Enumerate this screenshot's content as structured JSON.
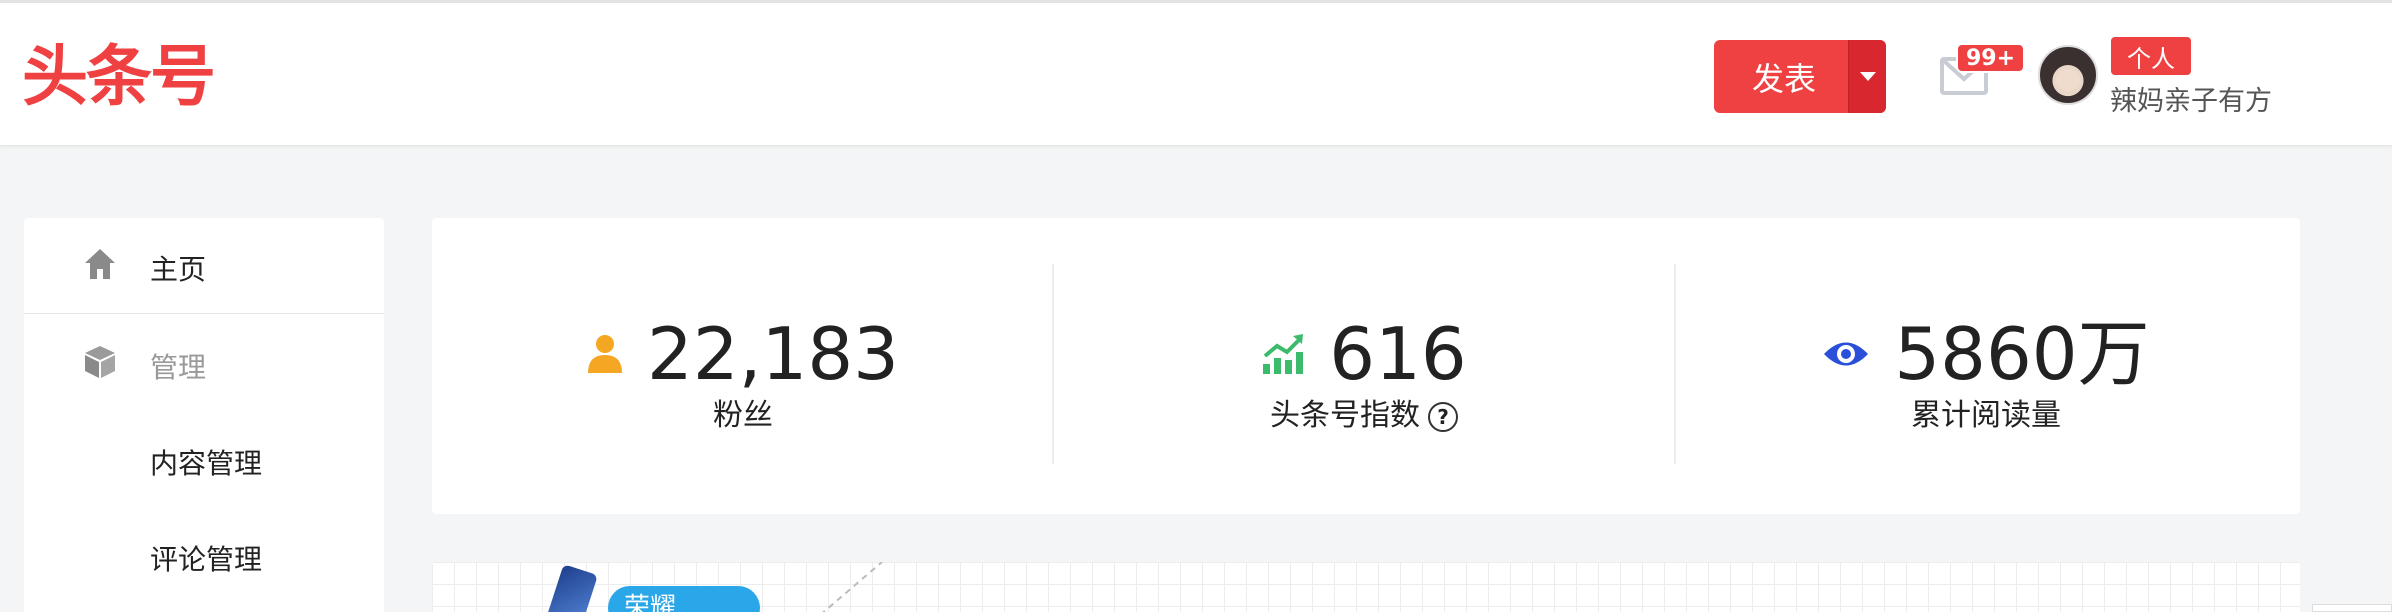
{
  "header": {
    "logo": "头条号",
    "publish_label": "发表",
    "mail_badge": "99+",
    "role_badge": "个人",
    "username": "辣妈亲子有方"
  },
  "sidebar": {
    "items": [
      {
        "label": "主页",
        "icon": "home-icon"
      },
      {
        "label": "管理",
        "icon": "cube-icon"
      },
      {
        "label": "内容管理"
      },
      {
        "label": "评论管理"
      }
    ]
  },
  "stats": [
    {
      "icon": "user-icon",
      "value": "22,183",
      "label": "粉丝",
      "color": "#f5a623"
    },
    {
      "icon": "trend-up-icon",
      "value": "616",
      "label": "头条号指数",
      "color": "#3dbb6c",
      "help": "?"
    },
    {
      "icon": "eye-icon",
      "value": "5860万",
      "label": "累计阅读量",
      "color": "#2a4fd8"
    }
  ],
  "banner": {
    "tag": "荣耀"
  },
  "colors": {
    "brand": "#f04142",
    "background": "#f4f5f6"
  }
}
